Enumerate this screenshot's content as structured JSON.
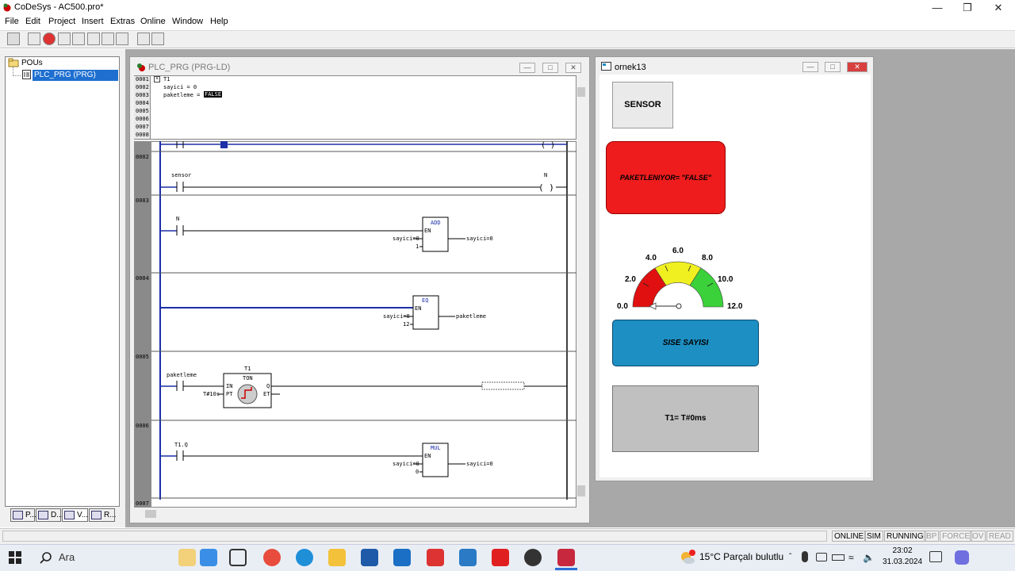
{
  "app": {
    "title": "CoDeSys - AC500.pro*"
  },
  "menu": [
    "File",
    "Edit",
    "Project",
    "Insert",
    "Extras",
    "Online",
    "Window",
    "Help"
  ],
  "pou_tree": {
    "root": "POUs",
    "item": "PLC_PRG (PRG)"
  },
  "pou_tabs": [
    "P...",
    "D...",
    "V...",
    "R..."
  ],
  "editor": {
    "title": "PLC_PRG (PRG-LD)",
    "decl_line_numbers": [
      "0001",
      "0002",
      "0003",
      "0004",
      "0005",
      "0006",
      "0007",
      "0008"
    ],
    "decl_lines": [
      "T1",
      "sayici = 0",
      "paketleme = "
    ],
    "decl_value": "FALSE",
    "rung_numbers": [
      "0002",
      "0003",
      "0004",
      "0005",
      "0006",
      "0007"
    ],
    "rung2": {
      "contact": "sensor",
      "coil": "N"
    },
    "rung3": {
      "contact": "N",
      "block": "ADD",
      "en": "EN",
      "in1": "sayici=0",
      "in2": "1",
      "out": "sayici=0"
    },
    "rung4": {
      "block": "EQ",
      "en": "EN",
      "in1": "sayici=0",
      "in2": "12",
      "out": "paketleme"
    },
    "rung5": {
      "contact": "paketleme",
      "instance": "T1",
      "block": "TON",
      "in": "IN",
      "pt": "PT",
      "pt_val": "T#10s",
      "q": "Q",
      "et": "ET"
    },
    "rung6": {
      "contact": "T1.Q",
      "block": "MUL",
      "en": "EN",
      "in1": "sayici=0",
      "in2": "0",
      "out": "sayici=0"
    }
  },
  "visu": {
    "title": "ornek13",
    "sensor_button": "SENSOR",
    "status_text": "PAKETLENIYOR= \"FALSE\"",
    "gauge_labels": [
      "0.0",
      "2.0",
      "4.0",
      "6.0",
      "8.0",
      "10.0",
      "12.0"
    ],
    "gauge_value": 0,
    "counter_label": "SISE SAYISI",
    "timer_text": "T1= T#0ms",
    "colors": {
      "status_bg": "#ee1c1c",
      "counter_bg": "#1d8fc3",
      "timer_bg": "#c0c0c0"
    }
  },
  "status": [
    "ONLINE",
    "SIM",
    "RUNNING",
    "BP",
    "FORCE",
    "OV",
    "READ"
  ],
  "taskbar": {
    "search": "Ara",
    "weather": "15°C  Parçalı bulutlu",
    "time": "23:02",
    "date": "31.03.2024"
  }
}
